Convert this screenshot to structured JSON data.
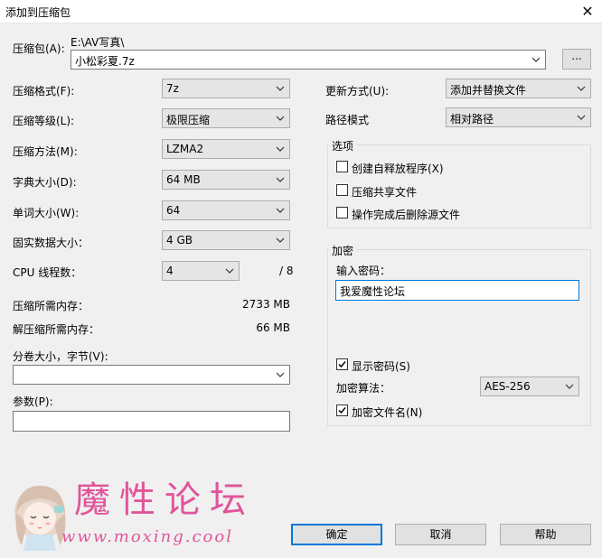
{
  "window": {
    "title": "添加到压缩包",
    "close_glyph": "✕"
  },
  "archive": {
    "label": "压缩包(A):",
    "path": "E:\\AV写真\\",
    "name": "小松彩夏.7z",
    "browse_label": "..."
  },
  "left": {
    "format": {
      "label": "压缩格式(F):",
      "value": "7z"
    },
    "level": {
      "label": "压缩等级(L):",
      "value": "极限压缩"
    },
    "method": {
      "label": "压缩方法(M):",
      "value": "LZMA2"
    },
    "dict": {
      "label": "字典大小(D):",
      "value": "64 MB"
    },
    "word": {
      "label": "单词大小(W):",
      "value": "64"
    },
    "solid": {
      "label": "固实数据大小：",
      "value": "4 GB"
    },
    "threads": {
      "label": "CPU 线程数：",
      "value": "4",
      "total": "/ 8"
    },
    "mem_compress": {
      "label": "压缩所需内存：",
      "value": "2733 MB"
    },
    "mem_decompress": {
      "label": "解压缩所需内存：",
      "value": "66 MB"
    },
    "volume": {
      "label": "分卷大小，字节(V):",
      "value": ""
    },
    "params": {
      "label": "参数(P):",
      "value": ""
    }
  },
  "right": {
    "update": {
      "label": "更新方式(U):",
      "value": "添加并替换文件"
    },
    "path_mode": {
      "label": "路径模式",
      "value": "相对路径"
    },
    "options": {
      "title": "选项",
      "sfx": {
        "label": "创建自释放程序(X)",
        "checked": false
      },
      "shared": {
        "label": "压缩共享文件",
        "checked": false
      },
      "delete": {
        "label": "操作完成后删除源文件",
        "checked": false
      }
    },
    "encryption": {
      "title": "加密",
      "password_label": "输入密码：",
      "password_value": "我爱魔性论坛",
      "show_password": {
        "label": "显示密码(S)",
        "checked": true
      },
      "method_label": "加密算法：",
      "method_value": "AES-256",
      "encrypt_names": {
        "label": "加密文件名(N)",
        "checked": true
      }
    }
  },
  "buttons": {
    "ok": "确定",
    "cancel": "取消",
    "help": "帮助"
  },
  "watermark": {
    "text": "魔性论坛",
    "url": "www.moxing.cool",
    "color": "#e0559a"
  }
}
